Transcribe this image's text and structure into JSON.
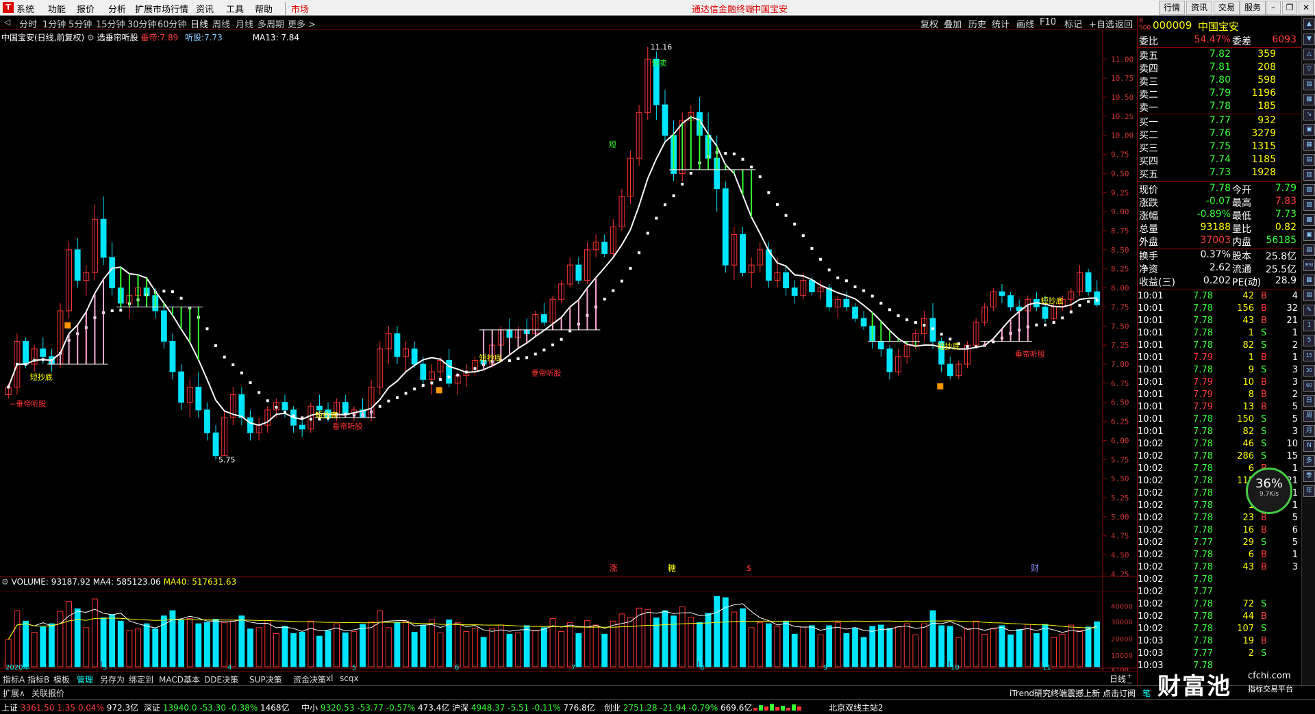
{
  "menubar": {
    "items": [
      "系统",
      "功能",
      "报价",
      "分析",
      "扩展市场行情",
      "资讯",
      "工具",
      "帮助"
    ],
    "active_item": "市场",
    "title": "通达信金融终端",
    "stock_title": "中国宝安",
    "right_buttons": [
      "行情",
      "资讯",
      "交易",
      "服务"
    ]
  },
  "periods": {
    "tabs": [
      "分时",
      "1分钟",
      "5分钟",
      "15分钟",
      "30分钟",
      "60分钟",
      "日线",
      "周线",
      "月线",
      "多周期",
      "更多 >"
    ],
    "selected": "日线"
  },
  "toolbar": {
    "buttons": [
      "复权",
      "叠加",
      "历史",
      "统计",
      "画线",
      "F10",
      "标记",
      "+自选",
      "返回"
    ]
  },
  "chart_info": {
    "stock_name": "中国宝安(日线,前复权)",
    "indicator": "选垂帘听股",
    "param_label": "垂帝:",
    "param_value": "7.89",
    "listen_label": "听股:",
    "listen_value": "7.73",
    "ma_label": "MA13: 7.84"
  },
  "price_axis": [
    "11.00",
    "10.75",
    "10.50",
    "10.25",
    "10.00",
    "9.75",
    "9.50",
    "9.25",
    "9.00",
    "8.75",
    "8.50",
    "8.25",
    "8.00",
    "7.75",
    "7.50",
    "7.25",
    "7.00",
    "6.75",
    "6.50",
    "6.25",
    "6.00",
    "5.75",
    "5.50",
    "5.25",
    "5.00",
    "4.75",
    "4.50",
    "4.25"
  ],
  "annotations": {
    "high": "11.16",
    "low": "5.75",
    "short_sell": "短卖",
    "short": "短",
    "labels": [
      "~垂帝听股",
      "垂帝听股",
      "垂帝听股",
      "垂帝听股",
      "短抄底",
      "短抄底",
      "短抄底",
      "短抄底",
      "短抄底",
      "短抄底"
    ],
    "events": [
      "涨",
      "糖",
      "$",
      "财"
    ]
  },
  "volume": {
    "label": "VOLUME: 93187.92",
    "ma4": "MA4: 585123.06",
    "ma40": "MA40: 517631.63",
    "axis": [
      "40000",
      "30000",
      "20000",
      "10000",
      "X100"
    ],
    "months": [
      "2020年",
      "3",
      "4",
      "5",
      "6",
      "7",
      "8",
      "9",
      "10",
      "11"
    ]
  },
  "quote": {
    "code": "000009",
    "name": "中国宝安",
    "weibi_label": "委比",
    "weibi": "54.47%",
    "weicha_label": "委差",
    "weicha": "6093",
    "sells": [
      {
        "label": "卖五",
        "price": "7.82",
        "vol": "359"
      },
      {
        "label": "卖四",
        "price": "7.81",
        "vol": "208"
      },
      {
        "label": "卖三",
        "price": "7.80",
        "vol": "598"
      },
      {
        "label": "卖二",
        "price": "7.79",
        "vol": "1196"
      },
      {
        "label": "卖一",
        "price": "7.78",
        "vol": "185"
      }
    ],
    "buys": [
      {
        "label": "买一",
        "price": "7.77",
        "vol": "932"
      },
      {
        "label": "买二",
        "price": "7.76",
        "vol": "3279"
      },
      {
        "label": "买三",
        "price": "7.75",
        "vol": "1315"
      },
      {
        "label": "买四",
        "price": "7.74",
        "vol": "1185"
      },
      {
        "label": "买五",
        "price": "7.73",
        "vol": "1928"
      }
    ],
    "stats": [
      {
        "l1": "现价",
        "v1": "7.78",
        "l2": "今开",
        "v2": "7.79",
        "c1": "green",
        "c2": "green"
      },
      {
        "l1": "涨跌",
        "v1": "-0.07",
        "l2": "最高",
        "v2": "7.83",
        "c1": "green",
        "c2": "red"
      },
      {
        "l1": "涨幅",
        "v1": "-0.89%",
        "l2": "最低",
        "v2": "7.73",
        "c1": "green",
        "c2": "green"
      },
      {
        "l1": "总量",
        "v1": "93188",
        "l2": "量比",
        "v2": "0.82",
        "c1": "yellow",
        "c2": "yellow"
      },
      {
        "l1": "外盘",
        "v1": "37003",
        "l2": "内盘",
        "v2": "56185",
        "c1": "red",
        "c2": "green"
      },
      {
        "l1": "换手",
        "v1": "0.37%",
        "l2": "股本",
        "v2": "25.8亿",
        "c1": "white",
        "c2": "white"
      },
      {
        "l1": "净资",
        "v1": "2.62",
        "l2": "流通",
        "v2": "25.5亿",
        "c1": "white",
        "c2": "white"
      },
      {
        "l1": "收益(三)",
        "v1": "0.202",
        "l2": "PE(动)",
        "v2": "28.9",
        "c1": "white",
        "c2": "white"
      }
    ],
    "ticks": [
      {
        "t": "10:01",
        "p": "7.78",
        "v": "42",
        "d": "B",
        "n": "4"
      },
      {
        "t": "10:01",
        "p": "7.78",
        "v": "156",
        "d": "B",
        "n": "32"
      },
      {
        "t": "10:01",
        "p": "7.78",
        "v": "43",
        "d": "B",
        "n": "21"
      },
      {
        "t": "10:01",
        "p": "7.78",
        "v": "1",
        "d": "S",
        "n": "1"
      },
      {
        "t": "10:01",
        "p": "7.78",
        "v": "82",
        "d": "S",
        "n": "2"
      },
      {
        "t": "10:01",
        "p": "7.79",
        "v": "1",
        "d": "B",
        "n": "1"
      },
      {
        "t": "10:01",
        "p": "7.78",
        "v": "9",
        "d": "S",
        "n": "3"
      },
      {
        "t": "10:01",
        "p": "7.79",
        "v": "10",
        "d": "B",
        "n": "3"
      },
      {
        "t": "10:01",
        "p": "7.79",
        "v": "8",
        "d": "B",
        "n": "2"
      },
      {
        "t": "10:01",
        "p": "7.79",
        "v": "13",
        "d": "B",
        "n": "5"
      },
      {
        "t": "10:01",
        "p": "7.78",
        "v": "150",
        "d": "S",
        "n": "5"
      },
      {
        "t": "10:01",
        "p": "7.78",
        "v": "82",
        "d": "S",
        "n": "3"
      },
      {
        "t": "10:02",
        "p": "7.78",
        "v": "46",
        "d": "S",
        "n": "10"
      },
      {
        "t": "10:02",
        "p": "7.78",
        "v": "286",
        "d": "S",
        "n": "15"
      },
      {
        "t": "10:02",
        "p": "7.78",
        "v": "6",
        "d": "B",
        "n": "1"
      },
      {
        "t": "10:02",
        "p": "7.78",
        "v": "115",
        "d": "B",
        "n": "21"
      },
      {
        "t": "10:02",
        "p": "7.78",
        "v": "5",
        "d": "B",
        "n": "1"
      },
      {
        "t": "10:02",
        "p": "7.78",
        "v": "1",
        "d": "B",
        "n": "1"
      },
      {
        "t": "10:02",
        "p": "7.78",
        "v": "23",
        "d": "B",
        "n": "5"
      },
      {
        "t": "10:02",
        "p": "7.78",
        "v": "16",
        "d": "B",
        "n": "6"
      },
      {
        "t": "10:02",
        "p": "7.77",
        "v": "29",
        "d": "S",
        "n": "5"
      },
      {
        "t": "10:02",
        "p": "7.78",
        "v": "6",
        "d": "B",
        "n": "1"
      },
      {
        "t": "10:02",
        "p": "7.78",
        "v": "43",
        "d": "B",
        "n": "3"
      },
      {
        "t": "10:02",
        "p": "7.78",
        "v": "",
        "d": "",
        "n": ""
      },
      {
        "t": "10:02",
        "p": "7.77",
        "v": "",
        "d": "",
        "n": ""
      },
      {
        "t": "10:02",
        "p": "7.78",
        "v": "72",
        "d": "S",
        "n": ""
      },
      {
        "t": "10:02",
        "p": "7.78",
        "v": "44",
        "d": "B",
        "n": ""
      },
      {
        "t": "10:02",
        "p": "7.78",
        "v": "107",
        "d": "S",
        "n": ""
      },
      {
        "t": "10:03",
        "p": "7.78",
        "v": "19",
        "d": "B",
        "n": ""
      },
      {
        "t": "10:03",
        "p": "7.77",
        "v": "2",
        "d": "S",
        "n": ""
      },
      {
        "t": "10:03",
        "p": "7.78",
        "v": "",
        "d": "",
        "n": ""
      }
    ],
    "speed": "36%",
    "speed_sub": "9.7K/s"
  },
  "bottom_tabs": [
    "指标A",
    "指标B",
    "模板",
    "管理",
    "另存为",
    "绑定到",
    "MACD基本",
    "DDE决策",
    "SUP决策",
    "资金决策",
    "xl",
    "scqx"
  ],
  "bottom_selected": "管理",
  "sub_tabs": [
    "扩展∧",
    "关联报价"
  ],
  "period_label": "日线",
  "news_ticker": "iTrend研究终端震撼上新 点击订阅",
  "watermark": "财富池",
  "watermark_site": "cfchi.com",
  "watermark_sub": "指标交易平台",
  "status": [
    {
      "name": "上证",
      "price": "3361.50",
      "chg": "1.35",
      "pct": "0.04%",
      "amt": "972.3亿",
      "color": "red"
    },
    {
      "name": "深证",
      "price": "13940.0",
      "chg": "-53.30",
      "pct": "-0.38%",
      "amt": "1468亿",
      "color": "green"
    },
    {
      "name": "中小",
      "price": "9320.53",
      "chg": "-53.77",
      "pct": "-0.57%",
      "amt": "473.4亿",
      "color": "green"
    },
    {
      "name": "沪深",
      "price": "4948.37",
      "chg": "-5.51",
      "pct": "-0.11%",
      "amt": "776.8亿",
      "color": "green"
    },
    {
      "name": "创业",
      "price": "2751.28",
      "chg": "-21.94",
      "pct": "-0.79%",
      "amt": "669.6亿",
      "color": "green"
    }
  ],
  "server": "北京双线主站2",
  "chart_data": {
    "type": "candlestick",
    "title": "中国宝安(日线,前复权)",
    "ylim": [
      4.2,
      11.2
    ],
    "ohlc": [
      [
        6.6,
        6.75,
        6.55,
        6.7
      ],
      [
        6.7,
        7.4,
        6.6,
        7.3
      ],
      [
        7.3,
        7.35,
        6.95,
        7.0
      ],
      [
        7.0,
        7.25,
        6.9,
        7.2
      ],
      [
        7.2,
        7.35,
        7.0,
        7.1
      ],
      [
        7.1,
        7.2,
        6.9,
        7.0
      ],
      [
        7.0,
        7.8,
        6.95,
        7.7
      ],
      [
        7.7,
        8.6,
        7.6,
        8.5
      ],
      [
        8.5,
        8.65,
        8.0,
        8.1
      ],
      [
        8.1,
        8.3,
        7.9,
        8.2
      ],
      [
        8.2,
        9.1,
        8.1,
        8.9
      ],
      [
        8.9,
        9.2,
        8.3,
        8.4
      ],
      [
        8.4,
        8.6,
        7.9,
        8.0
      ],
      [
        8.0,
        8.1,
        7.7,
        7.8
      ],
      [
        7.8,
        8.0,
        7.6,
        7.9
      ],
      [
        7.9,
        8.1,
        7.8,
        8.0
      ],
      [
        8.0,
        8.15,
        7.85,
        7.9
      ],
      [
        7.9,
        8.0,
        7.6,
        7.7
      ],
      [
        7.7,
        7.8,
        7.2,
        7.3
      ],
      [
        7.3,
        7.4,
        6.8,
        6.9
      ],
      [
        6.9,
        7.0,
        6.4,
        6.5
      ],
      [
        6.5,
        6.8,
        6.3,
        6.7
      ],
      [
        6.7,
        6.9,
        6.3,
        6.4
      ],
      [
        6.4,
        6.5,
        6.0,
        6.1
      ],
      [
        6.1,
        6.2,
        5.75,
        5.8
      ],
      [
        5.8,
        6.4,
        5.8,
        6.3
      ],
      [
        6.3,
        6.7,
        6.2,
        6.6
      ],
      [
        6.6,
        6.7,
        6.2,
        6.3
      ],
      [
        6.3,
        6.4,
        6.0,
        6.1
      ],
      [
        6.1,
        6.3,
        6.0,
        6.2
      ],
      [
        6.2,
        6.45,
        6.1,
        6.4
      ],
      [
        6.4,
        6.55,
        6.3,
        6.5
      ],
      [
        6.5,
        6.6,
        6.3,
        6.4
      ],
      [
        6.4,
        6.45,
        6.1,
        6.2
      ],
      [
        6.2,
        6.3,
        6.05,
        6.15
      ],
      [
        6.15,
        6.5,
        6.1,
        6.45
      ],
      [
        6.45,
        6.6,
        6.35,
        6.4
      ],
      [
        6.4,
        6.5,
        6.25,
        6.3
      ],
      [
        6.3,
        6.55,
        6.25,
        6.5
      ],
      [
        6.5,
        6.6,
        6.3,
        6.35
      ],
      [
        6.35,
        6.45,
        6.25,
        6.4
      ],
      [
        6.4,
        6.55,
        6.3,
        6.3
      ],
      [
        6.3,
        6.8,
        6.25,
        6.7
      ],
      [
        6.7,
        7.3,
        6.6,
        7.2
      ],
      [
        7.2,
        7.5,
        7.0,
        7.4
      ],
      [
        7.4,
        7.5,
        7.0,
        7.1
      ],
      [
        7.1,
        7.3,
        6.9,
        7.2
      ],
      [
        7.2,
        7.3,
        6.95,
        7.0
      ],
      [
        7.0,
        7.1,
        6.7,
        6.8
      ],
      [
        6.8,
        7.0,
        6.6,
        6.9
      ],
      [
        6.9,
        7.1,
        6.8,
        7.05
      ],
      [
        7.05,
        7.2,
        6.7,
        6.75
      ],
      [
        6.75,
        6.9,
        6.6,
        6.85
      ],
      [
        6.85,
        7.0,
        6.7,
        6.9
      ],
      [
        6.9,
        7.1,
        6.85,
        7.05
      ],
      [
        7.05,
        7.2,
        6.95,
        7.0
      ],
      [
        7.0,
        7.3,
        6.95,
        7.25
      ],
      [
        7.25,
        7.5,
        7.2,
        7.45
      ],
      [
        7.45,
        7.6,
        7.3,
        7.35
      ],
      [
        7.35,
        7.5,
        7.3,
        7.45
      ],
      [
        7.45,
        7.6,
        7.35,
        7.4
      ],
      [
        7.4,
        7.7,
        7.35,
        7.65
      ],
      [
        7.65,
        7.8,
        7.5,
        7.55
      ],
      [
        7.55,
        7.9,
        7.5,
        7.85
      ],
      [
        7.85,
        8.1,
        7.8,
        8.05
      ],
      [
        8.05,
        8.4,
        8.0,
        8.3
      ],
      [
        8.3,
        8.4,
        8.05,
        8.1
      ],
      [
        8.1,
        8.6,
        8.05,
        8.5
      ],
      [
        8.5,
        8.7,
        8.4,
        8.6
      ],
      [
        8.6,
        8.7,
        8.4,
        8.45
      ],
      [
        8.45,
        8.9,
        8.4,
        8.8
      ],
      [
        8.8,
        9.3,
        8.75,
        9.2
      ],
      [
        9.2,
        9.8,
        9.1,
        9.7
      ],
      [
        9.7,
        10.4,
        9.6,
        10.3
      ],
      [
        10.3,
        11.16,
        10.2,
        11.0
      ],
      [
        11.0,
        11.1,
        10.2,
        10.4
      ],
      [
        10.4,
        10.6,
        9.9,
        10.0
      ],
      [
        10.0,
        10.2,
        9.4,
        9.5
      ],
      [
        9.5,
        10.3,
        9.4,
        10.2
      ],
      [
        10.2,
        10.4,
        9.9,
        10.3
      ],
      [
        10.3,
        10.5,
        9.9,
        10.0
      ],
      [
        10.0,
        10.3,
        9.6,
        9.7
      ],
      [
        9.7,
        10.0,
        9.0,
        9.3
      ],
      [
        9.3,
        9.4,
        8.2,
        8.3
      ],
      [
        8.3,
        8.8,
        8.1,
        8.7
      ],
      [
        8.7,
        8.8,
        8.15,
        8.2
      ],
      [
        8.2,
        8.4,
        8.0,
        8.3
      ],
      [
        8.3,
        8.6,
        8.2,
        8.5
      ],
      [
        8.5,
        8.6,
        8.0,
        8.1
      ],
      [
        8.1,
        8.4,
        8.0,
        8.2
      ],
      [
        8.2,
        8.3,
        7.9,
        8.0
      ],
      [
        8.0,
        8.1,
        7.8,
        7.9
      ],
      [
        7.9,
        8.2,
        7.85,
        8.1
      ],
      [
        8.1,
        8.15,
        7.9,
        7.95
      ],
      [
        7.95,
        8.1,
        7.85,
        8.0
      ],
      [
        8.0,
        8.05,
        7.7,
        7.75
      ],
      [
        7.75,
        7.9,
        7.6,
        7.85
      ],
      [
        7.85,
        7.95,
        7.7,
        7.75
      ],
      [
        7.75,
        7.8,
        7.55,
        7.6
      ],
      [
        7.6,
        7.7,
        7.45,
        7.5
      ],
      [
        7.5,
        7.6,
        7.2,
        7.3
      ],
      [
        7.3,
        7.4,
        7.1,
        7.2
      ],
      [
        7.2,
        7.25,
        6.8,
        6.9
      ],
      [
        6.9,
        7.2,
        6.85,
        7.1
      ],
      [
        7.1,
        7.3,
        7.0,
        7.25
      ],
      [
        7.25,
        7.45,
        7.2,
        7.4
      ],
      [
        7.4,
        7.7,
        7.3,
        7.6
      ],
      [
        7.6,
        7.8,
        7.2,
        7.3
      ],
      [
        7.3,
        7.35,
        6.9,
        7.0
      ],
      [
        7.0,
        7.1,
        6.8,
        6.85
      ],
      [
        6.85,
        7.05,
        6.8,
        7.0
      ],
      [
        7.0,
        7.3,
        6.95,
        7.25
      ],
      [
        7.25,
        7.6,
        7.2,
        7.55
      ],
      [
        7.55,
        7.8,
        7.5,
        7.75
      ],
      [
        7.75,
        8.0,
        7.7,
        7.95
      ],
      [
        7.95,
        8.05,
        7.8,
        7.9
      ],
      [
        7.9,
        7.95,
        7.7,
        7.75
      ],
      [
        7.75,
        7.85,
        7.6,
        7.7
      ],
      [
        7.7,
        7.9,
        7.65,
        7.85
      ],
      [
        7.85,
        7.95,
        7.7,
        7.75
      ],
      [
        7.75,
        7.9,
        7.55,
        7.6
      ],
      [
        7.6,
        7.8,
        7.55,
        7.75
      ],
      [
        7.75,
        7.9,
        7.7,
        7.85
      ],
      [
        7.85,
        8.0,
        7.7,
        7.95
      ],
      [
        7.95,
        8.3,
        7.9,
        8.2
      ],
      [
        8.2,
        8.25,
        7.9,
        7.95
      ],
      [
        7.95,
        8.1,
        7.75,
        7.78
      ]
    ]
  }
}
